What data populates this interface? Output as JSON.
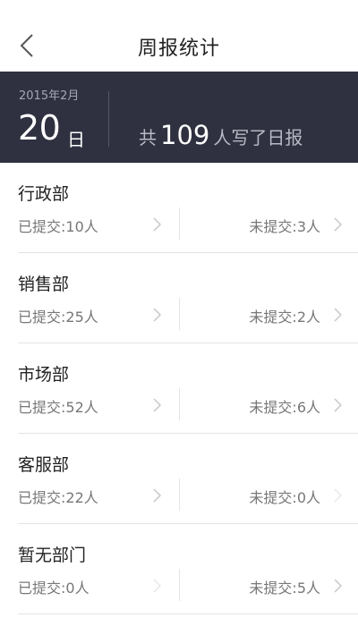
{
  "header": {
    "title": "周报统计",
    "back_icon": "chevron-left-icon"
  },
  "summary": {
    "year_month": "2015年2月",
    "day": "20",
    "day_unit": "日",
    "total_prefix": "共",
    "total_count": "109",
    "total_suffix": "人写了日报"
  },
  "departments": [
    {
      "name": "行政部",
      "submitted": "已提交:10人",
      "not_submitted": "未提交:3人"
    },
    {
      "name": "销售部",
      "submitted": "已提交:25人",
      "not_submitted": "未提交:2人"
    },
    {
      "name": "市场部",
      "submitted": "已提交:52人",
      "not_submitted": "未提交:6人"
    },
    {
      "name": "客服部",
      "submitted": "已提交:22人",
      "not_submitted": "未提交:0人"
    },
    {
      "name": "暂无部门",
      "submitted": "已提交:0人",
      "not_submitted": "未提交:5人"
    }
  ],
  "colors": {
    "banner_bg": "#2f3040",
    "divider": "#e4e4e4",
    "chevron": "#c8c8c8",
    "chevron_disabled": "#e8e8e8"
  }
}
